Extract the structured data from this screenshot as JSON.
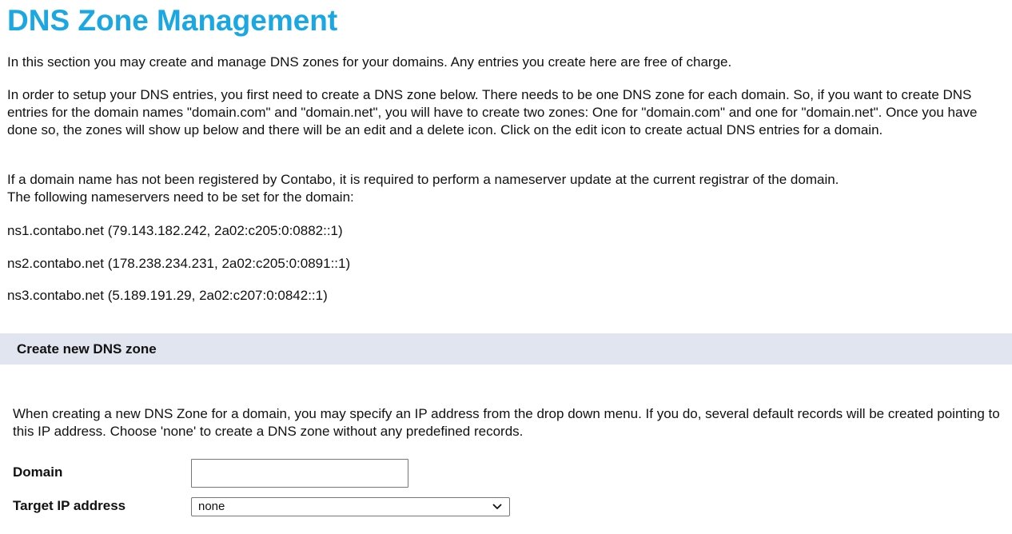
{
  "header": {
    "title": "DNS Zone Management"
  },
  "intro": {
    "p1": "In this section you may create and manage DNS zones for your domains. Any entries you create here are free of charge.",
    "p2": "In order to setup your DNS entries, you first need to create a DNS zone below. There needs to be one DNS zone for each domain. So, if you want to create DNS entries for the domain names \"domain.com\" and \"domain.net\", you will have to create two zones: One for \"domain.com\" and one for \"domain.net\". Once you have done so, the zones will show up below and there will be an edit and a delete icon. Click on the edit icon to create actual DNS entries for a domain.",
    "p3_line1": "If a domain name has not been registered by Contabo, it is required to perform a nameserver update at the current registrar of the domain.",
    "p3_line2": "The following nameservers need to be set for the domain:"
  },
  "nameservers": [
    "ns1.contabo.net (79.143.182.242, 2a02:c205:0:0882::1)",
    "ns2.contabo.net (178.238.234.231, 2a02:c205:0:0891::1)",
    "ns3.contabo.net (5.189.191.29, 2a02:c207:0:0842::1)"
  ],
  "create_section": {
    "title": "Create new DNS zone",
    "description": "When creating a new DNS Zone for a domain, you may specify an IP address from the drop down menu. If you do, several default records will be created pointing to this IP address. Choose 'none' to create a DNS zone without any predefined records.",
    "domain_label": "Domain",
    "domain_value": "",
    "target_ip_label": "Target IP address",
    "target_ip_selected": "none"
  },
  "icons": {
    "select_chevron": "chevron-down-icon"
  },
  "colors": {
    "title": "#1aa7e2",
    "section_bar": "#e0e5f0"
  }
}
